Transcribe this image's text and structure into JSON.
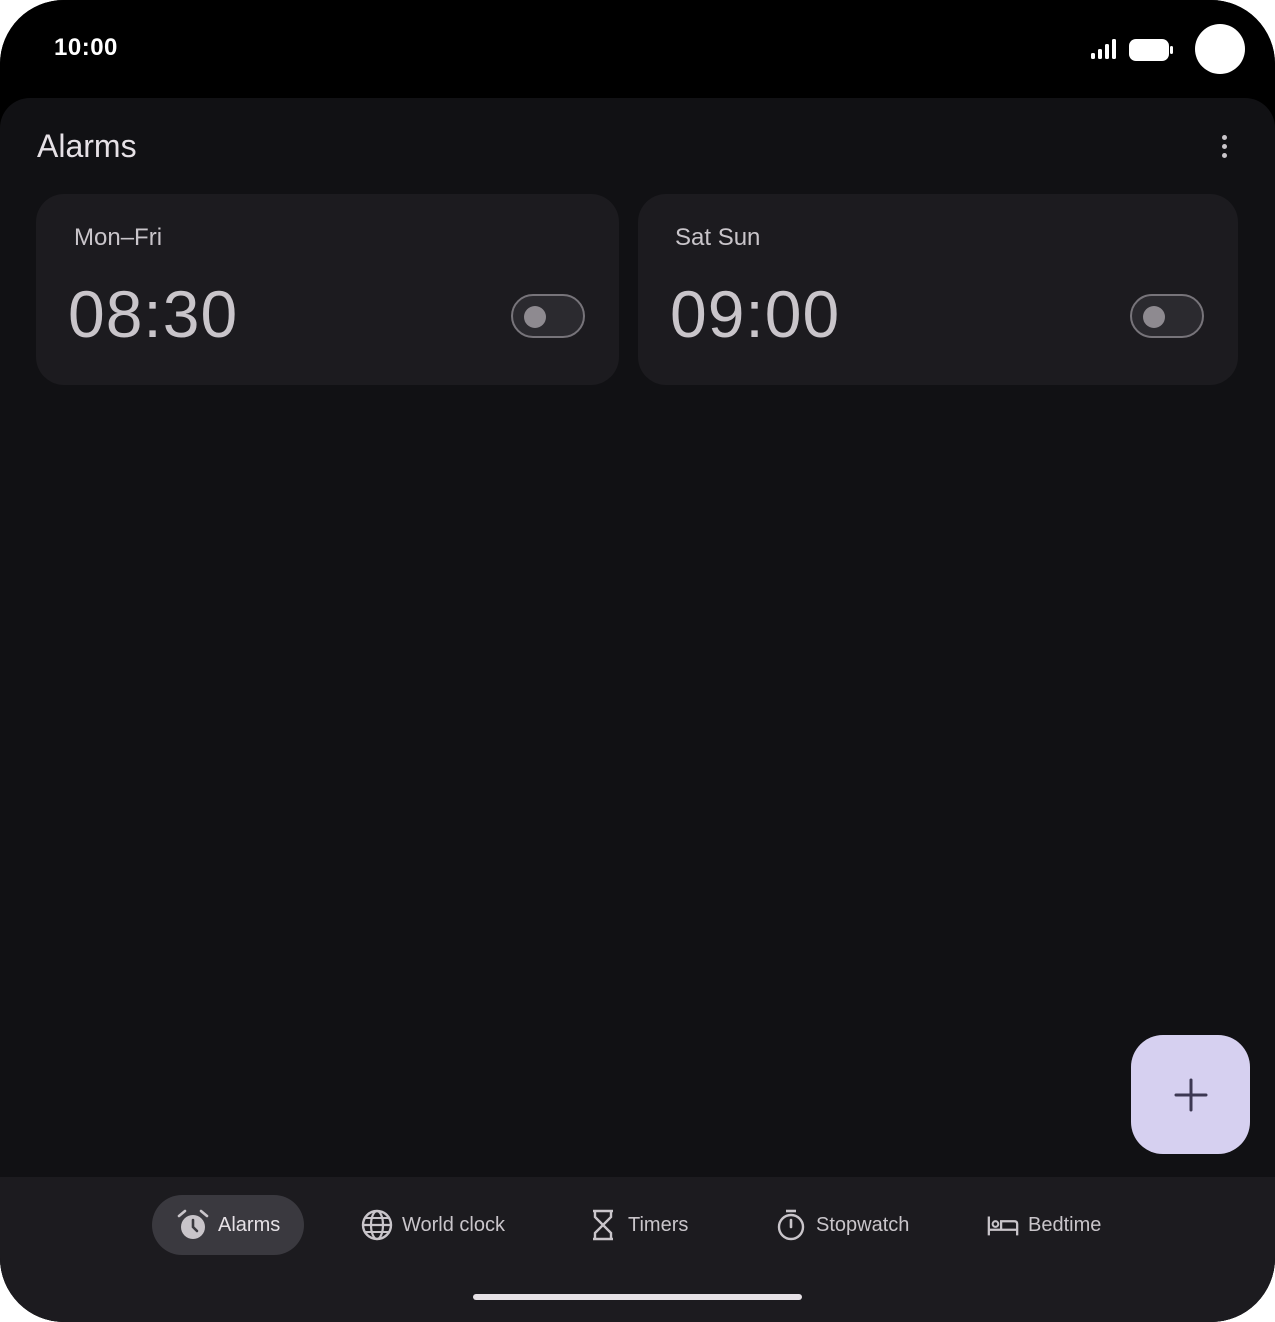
{
  "status_bar": {
    "time": "10:00"
  },
  "header": {
    "title": "Alarms",
    "more_icon": "more-vert-icon"
  },
  "alarms": [
    {
      "days": "Mon–Fri",
      "time": "08:30",
      "enabled": false
    },
    {
      "days": "Sat Sun",
      "time": "09:00",
      "enabled": false
    }
  ],
  "fab": {
    "icon": "plus-icon"
  },
  "bottom_nav": {
    "items": [
      {
        "label": "Alarms",
        "icon": "alarm-icon",
        "active": true
      },
      {
        "label": "World clock",
        "icon": "globe-icon",
        "active": false
      },
      {
        "label": "Timers",
        "icon": "hourglass-icon",
        "active": false
      },
      {
        "label": "Stopwatch",
        "icon": "stopwatch-icon",
        "active": false
      },
      {
        "label": "Bedtime",
        "icon": "bed-icon",
        "active": false
      }
    ]
  },
  "colors": {
    "background": "#111114",
    "card": "#1c1b1f",
    "fab": "#d6d0f0",
    "text": "#c9c5ca"
  }
}
